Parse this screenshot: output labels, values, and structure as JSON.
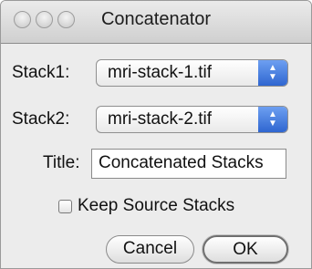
{
  "window": {
    "title": "Concatenator"
  },
  "form": {
    "stack1_label": "Stack1:",
    "stack1_value": "mri-stack-1.tif",
    "stack2_label": "Stack2:",
    "stack2_value": "mri-stack-2.tif",
    "title_label": "Title:",
    "title_value": "Concatenated Stacks",
    "keep_label": "Keep Source Stacks",
    "keep_checked": false
  },
  "buttons": {
    "cancel": "Cancel",
    "ok": "OK"
  }
}
